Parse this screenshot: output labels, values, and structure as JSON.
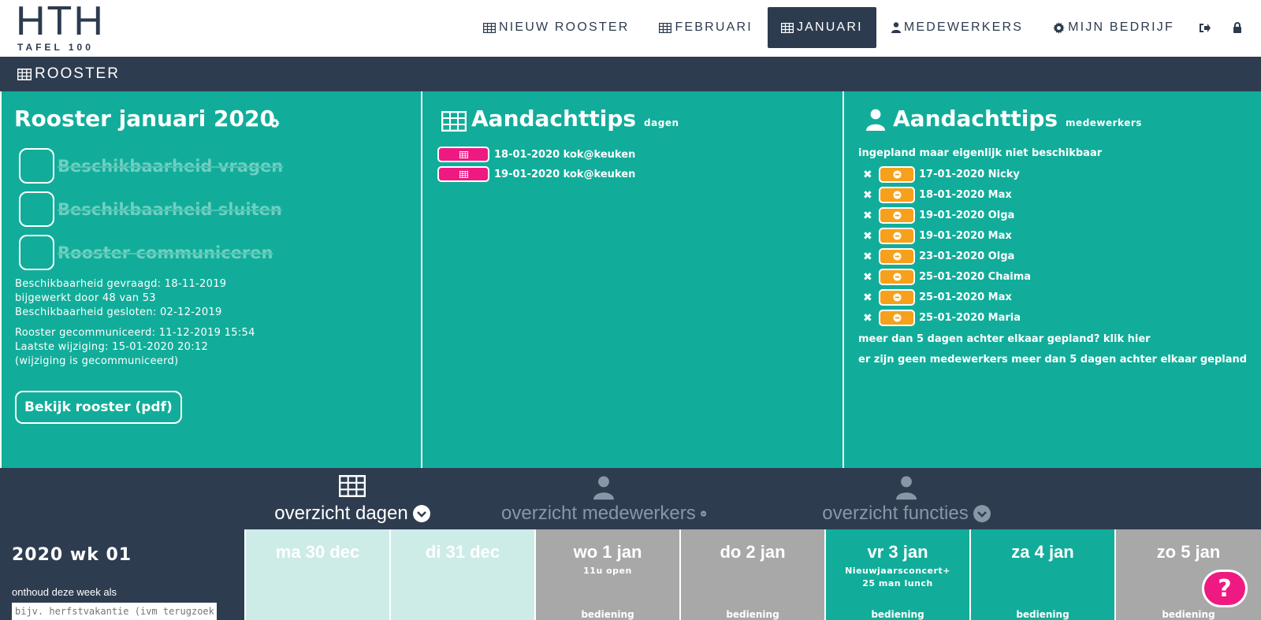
{
  "logo": {
    "mark": "HTH",
    "sub": "TAFEL 100"
  },
  "nav": {
    "items": [
      {
        "label": "NIEUW ROOSTER",
        "icon": "table-icon"
      },
      {
        "label": "FEBRUARI",
        "icon": "table-icon"
      },
      {
        "label": "JANUARI",
        "icon": "table-icon",
        "active": true
      },
      {
        "label": "MEDEWERKERS",
        "icon": "user-icon"
      },
      {
        "label": "MIJN BEDRIJF",
        "icon": "gear-icon"
      }
    ],
    "logout_icon": "sign-out-icon",
    "lock_icon": "lock-icon"
  },
  "section": {
    "title": "ROOSTER",
    "icon": "table-icon"
  },
  "rooster_panel": {
    "title": "Rooster januari 2020",
    "steps": [
      "Beschikbaarheid vragen",
      "Beschikbaarheid sluiten",
      "Rooster communiceren"
    ],
    "info1": [
      "Beschikbaarheid gevraagd: 18-11-2019",
      "bijgewerkt door 48 van 53",
      "Beschikbaarheid gesloten: 02-12-2019"
    ],
    "info2": [
      "Rooster gecommuniceerd: 11-12-2019 15:54",
      "Laatste wijziging: 15-01-2020 20:12",
      "(wijziging is gecommuniceerd)"
    ],
    "pdf_button": "Bekijk rooster (pdf)"
  },
  "tips_days": {
    "title": "Aandachttips",
    "subtitle": "dagen",
    "items": [
      "18-01-2020 kok@keuken",
      "19-01-2020 kok@keuken"
    ]
  },
  "tips_employees": {
    "title": "Aandachttips",
    "subtitle": "medewerkers",
    "intro": "ingepland maar eigenlijk niet beschikbaar",
    "items": [
      "17-01-2020 Nicky",
      "18-01-2020 Max",
      "19-01-2020 Olga",
      "19-01-2020 Max",
      "23-01-2020 Olga",
      "25-01-2020 Chaima",
      "25-01-2020 Max",
      "25-01-2020 Maria"
    ],
    "more_link": "meer dan 5 dagen achter elkaar gepland? klik hier",
    "more_info": "er zijn geen medewerkers meer dan 5 dagen achter elkaar gepland"
  },
  "overview": {
    "tabs": [
      {
        "label": "overzicht dagen",
        "icon": "table-icon",
        "active": true
      },
      {
        "label": "overzicht medewerkers",
        "icon": "user-icon"
      },
      {
        "label": "overzicht functies",
        "icon": "user-icon"
      }
    ]
  },
  "week": {
    "title": "2020 wk 01",
    "remember_label": "onthoud deze week als",
    "remember_placeholder": "bijv. herfstvakantie (ivm terugzoeken)",
    "days": [
      {
        "name": "ma 30 dec",
        "note": "",
        "role": "",
        "state": "past"
      },
      {
        "name": "di 31 dec",
        "note": "",
        "role": "",
        "state": "past"
      },
      {
        "name": "wo 1 jan",
        "note": "11u open",
        "note2": "",
        "role": "bediening",
        "state": "grey"
      },
      {
        "name": "do 2 jan",
        "note": "",
        "note2": "",
        "role": "bediening",
        "state": "grey"
      },
      {
        "name": "vr 3 jan",
        "note": "Nieuwjaarsconcert+",
        "note2": "25 man lunch",
        "role": "bediening",
        "state": "teal"
      },
      {
        "name": "za 4 jan",
        "note": "",
        "note2": "",
        "role": "bediening",
        "state": "teal"
      },
      {
        "name": "zo 5 jan",
        "note": "",
        "note2": "",
        "role": "bediening",
        "state": "grey"
      }
    ]
  },
  "help": {
    "label": "?"
  },
  "colors": {
    "navy": "#2e3c50",
    "teal": "#11ad9a",
    "pink": "#ee1a82",
    "orange": "#f7a01b",
    "grey": "#a8a8a8",
    "light_teal": "#cdece8"
  }
}
